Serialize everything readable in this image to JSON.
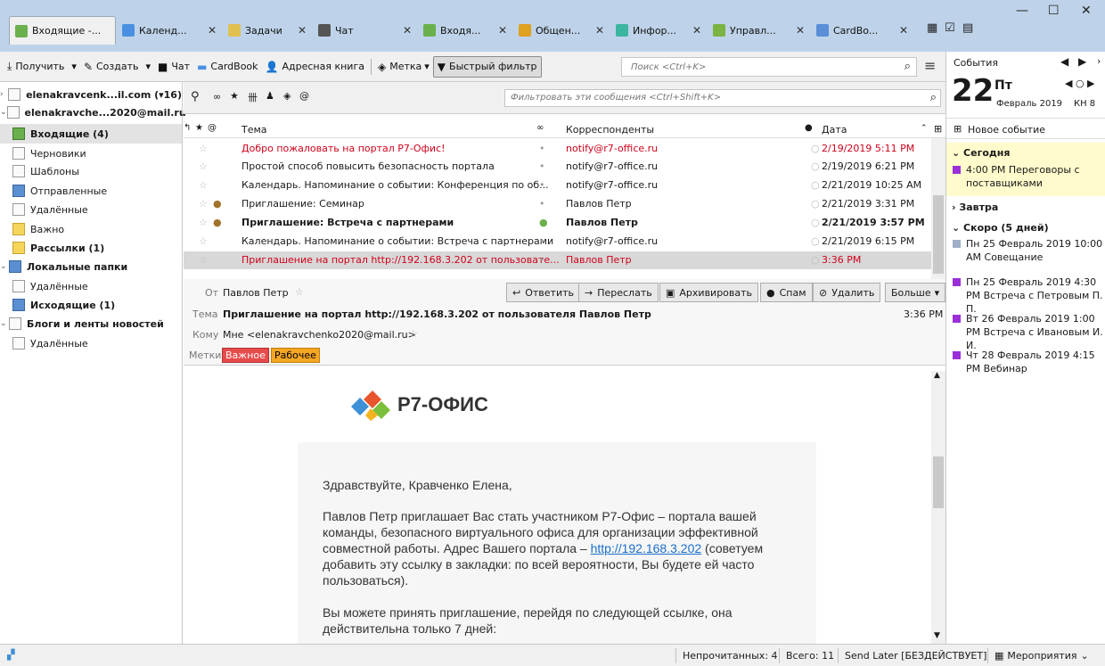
{
  "tabs": [
    {
      "label": "Входящие -...",
      "icon": "inbox-icon",
      "active": true
    },
    {
      "label": "Календ...",
      "icon": "calendar-icon"
    },
    {
      "label": "Задачи",
      "icon": "tasks-icon"
    },
    {
      "label": "Чат",
      "icon": "chat-icon"
    },
    {
      "label": "Входя...",
      "icon": "inbox-icon"
    },
    {
      "label": "Общен...",
      "icon": "community-icon"
    },
    {
      "label": "Инфор...",
      "icon": "info-icon"
    },
    {
      "label": "Управл...",
      "icon": "addons-icon"
    },
    {
      "label": "CardBo...",
      "icon": "cardbook-icon"
    }
  ],
  "window_controls": {
    "minimize": "—",
    "maximize": "☐",
    "close": "✕"
  },
  "toolbar": {
    "get": "Получить",
    "write": "Создать",
    "chat": "Чат",
    "cardbook": "CardBook",
    "address_book": "Адресная книга",
    "tag": "Метка",
    "quick_filter": "Быстрый фильтр",
    "search_placeholder": "Поиск <Ctrl+K>"
  },
  "folders": [
    {
      "label": "elenakravcenk...il.com (▾16)",
      "level": 0,
      "bold": true
    },
    {
      "label": "elenakravche...2020@mail.ru",
      "level": 0,
      "bold": true
    },
    {
      "label": "Входящие (4)",
      "level": 1,
      "bold": true,
      "selected": true,
      "icon": "inbox-icon"
    },
    {
      "label": "Черновики",
      "level": 1,
      "icon": "drafts-icon"
    },
    {
      "label": "Шаблоны",
      "level": 1,
      "icon": "templates-icon"
    },
    {
      "label": "Отправленные",
      "level": 1,
      "icon": "sent-icon"
    },
    {
      "label": "Удалённые",
      "level": 1,
      "icon": "trash-icon"
    },
    {
      "label": "Важно",
      "level": 1,
      "icon": "folder-icon"
    },
    {
      "label": "Рассылки (1)",
      "level": 1,
      "bold": true,
      "icon": "folder-icon"
    },
    {
      "label": "Локальные папки",
      "level": 0,
      "bold": true
    },
    {
      "label": "Удалённые",
      "level": 1,
      "icon": "trash-icon"
    },
    {
      "label": "Исходящие (1)",
      "level": 1,
      "bold": true,
      "icon": "outbox-icon"
    },
    {
      "label": "Блоги и ленты новостей",
      "level": 0,
      "bold": true
    },
    {
      "label": "Удалённые",
      "level": 1,
      "icon": "trash-icon"
    }
  ],
  "list_filter": {
    "placeholder": "Фильтровать эти сообщения <Ctrl+Shift+K>"
  },
  "columns": {
    "subject": "Тема",
    "correspondents": "Корреспонденты",
    "date": "Дата"
  },
  "messages": [
    {
      "subject": "Добро пожаловать на портал Р7-Офис!",
      "from": "notify@r7-office.ru",
      "date": "2/19/2019 5:11 PM",
      "style": "red"
    },
    {
      "subject": "Простой способ повысить безопасность портала",
      "from": "notify@r7-office.ru",
      "date": "2/19/2019 6:21 PM"
    },
    {
      "subject": "Календарь. Напоминание о событии: Конференция по об...",
      "from": "notify@r7-office.ru",
      "date": "2/21/2019 10:25 AM"
    },
    {
      "subject": "Приглашение: Семинар",
      "from": "Павлов Петр",
      "date": "2/21/2019 3:31 PM",
      "attach": true
    },
    {
      "subject": "Приглашение: Встреча с партнерами",
      "from": "Павлов Петр",
      "date": "2/21/2019 3:57 PM",
      "style": "bold",
      "attach": true,
      "unread": true
    },
    {
      "subject": "Календарь. Напоминание о событии: Встреча с партнерами",
      "from": "notify@r7-office.ru",
      "date": "2/21/2019 6:15 PM"
    },
    {
      "subject": "Приглашение на портал http://192.168.3.202 от пользовате...",
      "from": "Павлов Петр",
      "date": "3:36 PM",
      "style": "red",
      "selected": true
    }
  ],
  "header": {
    "from_label": "От",
    "from": "Павлов Петр",
    "subject_label": "Тема",
    "subject": "Приглашение на портал http://192.168.3.202 от пользователя Павлов Петр",
    "time": "3:36 PM",
    "to_label": "Кому",
    "to": "Мне <elenakravchenko2020@mail.ru>",
    "tags_label": "Метки",
    "tags": [
      {
        "label": "Важное",
        "color": "#e84b4b"
      },
      {
        "label": "Рабочее",
        "color": "#f5a623"
      }
    ],
    "actions": {
      "reply": "Ответить",
      "forward": "Переслать",
      "archive": "Архивировать",
      "spam": "Спам",
      "delete": "Удалить",
      "more": "Больше"
    }
  },
  "body": {
    "logo_text": "Р7-ОФИС",
    "greeting": "Здравствуйте, Кравченко Елена,",
    "p1_before": "Павлов Петр приглашает Вас стать участником Р7-Офис – портала вашей команды, безопасного виртуального офиса для организации эффективной совместной работы. Адрес Вашего портала – ",
    "link": "http://192.168.3.202",
    "p1_after": " (советуем добавить эту ссылку в закладки: по всей вероятности, Вы будете ей часто пользоваться).",
    "p2": "Вы можете принять приглашение, перейдя по следующей ссылке, она действительна только 7 дней:"
  },
  "events_pane": {
    "title": "События",
    "day": "22",
    "weekday": "Пт",
    "month_year": "Февраль 2019",
    "week": "КН 8",
    "new_event": "Новое событие",
    "groups": [
      {
        "label": "Сегодня",
        "items": [
          {
            "text": "4:00 PM Переговоры с поставщиками",
            "color": "#9b30d9"
          }
        ]
      },
      {
        "label": "Завтра",
        "items": []
      },
      {
        "label": "Скоро (5 дней)",
        "items": [
          {
            "text": "Пн 25 Февраль 2019 10:00 AM Совещание",
            "color": "#a0aec8"
          },
          {
            "text": "Пн 25 Февраль 2019 4:30 PM Встреча с Петровым П. П.",
            "color": "#9b30d9"
          },
          {
            "text": "Вт 26 Февраль 2019 1:00 PM Встреча с Ивановым И. И.",
            "color": "#9b30d9"
          },
          {
            "text": "Чт 28 Февраль 2019 4:15 PM Вебинар",
            "color": "#9b30d9"
          }
        ]
      }
    ]
  },
  "status": {
    "unread": "Непрочитанных: 4",
    "total": "Всего: 11",
    "send_later": "Send Later [БЕЗДЕЙСТВУЕТ]",
    "events": "Мероприятия"
  },
  "colors": {
    "accent_red": "#d0021b",
    "tabbar": "#bed3e9",
    "today_bg": "#fffbcc",
    "selection": "#d8d8d8"
  }
}
